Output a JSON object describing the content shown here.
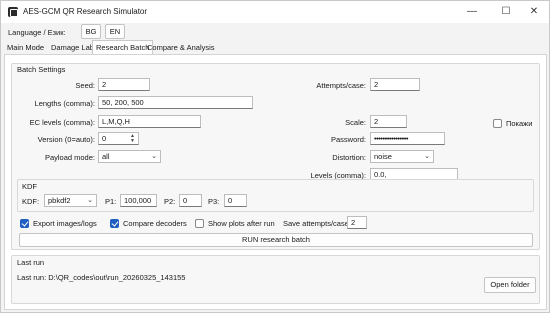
{
  "window": {
    "title": "AES-GCM QR Research Simulator",
    "minimize": "—",
    "maximize": "☐",
    "close": "✕"
  },
  "language": {
    "label": "Language / Език:",
    "bg": "BG",
    "en": "EN"
  },
  "tabs": [
    {
      "label": "Main Mode"
    },
    {
      "label": "Damage Lab"
    },
    {
      "label": "Research Batch"
    },
    {
      "label": "Compare & Analysis"
    }
  ],
  "batch_settings": {
    "title": "Batch Settings",
    "seed_label": "Seed:",
    "seed_value": "2",
    "lengths_label": "Lengths (comma):",
    "lengths_value": "50, 200, 500",
    "ec_label": "EC levels (comma):",
    "ec_value": "L,M,Q,H",
    "version_label": "Version (0=auto):",
    "version_value": "0",
    "payload_label": "Payload mode:",
    "payload_value": "all",
    "attempts_label": "Attempts/case:",
    "attempts_value": "2",
    "scale_label": "Scale:",
    "scale_value": "2",
    "password_label": "Password:",
    "password_value": "••••••••••••••••",
    "show_label": "Покажи",
    "distortion_label": "Distortion:",
    "distortion_value": "noise",
    "levels_label": "Levels (comma):",
    "levels_value": "0.0,"
  },
  "kdf": {
    "title": "KDF",
    "kdf_label": "KDF:",
    "kdf_value": "pbkdf2",
    "p1_label": "P1:",
    "p1_value": "100,000",
    "p2_label": "P2:",
    "p2_value": "0",
    "p3_label": "P3:",
    "p3_value": "0"
  },
  "options": {
    "export_label": "Export images/logs",
    "compare_label": "Compare decoders",
    "show_plots_label": "Show plots after run",
    "save_attempts_label": "Save attempts/case:",
    "save_attempts_value": "2",
    "export_checked": true,
    "compare_checked": true,
    "show_plots_checked": false
  },
  "run_button": "RUN research batch",
  "last_run": {
    "title": "Last run",
    "text": "Last run: D:\\QR_codes\\out\\run_20260325_143155",
    "open_folder": "Open folder"
  },
  "colors": {
    "accent": "#1f5fc2",
    "panel": "#f7f7f7",
    "window": "#f3f3f3"
  }
}
